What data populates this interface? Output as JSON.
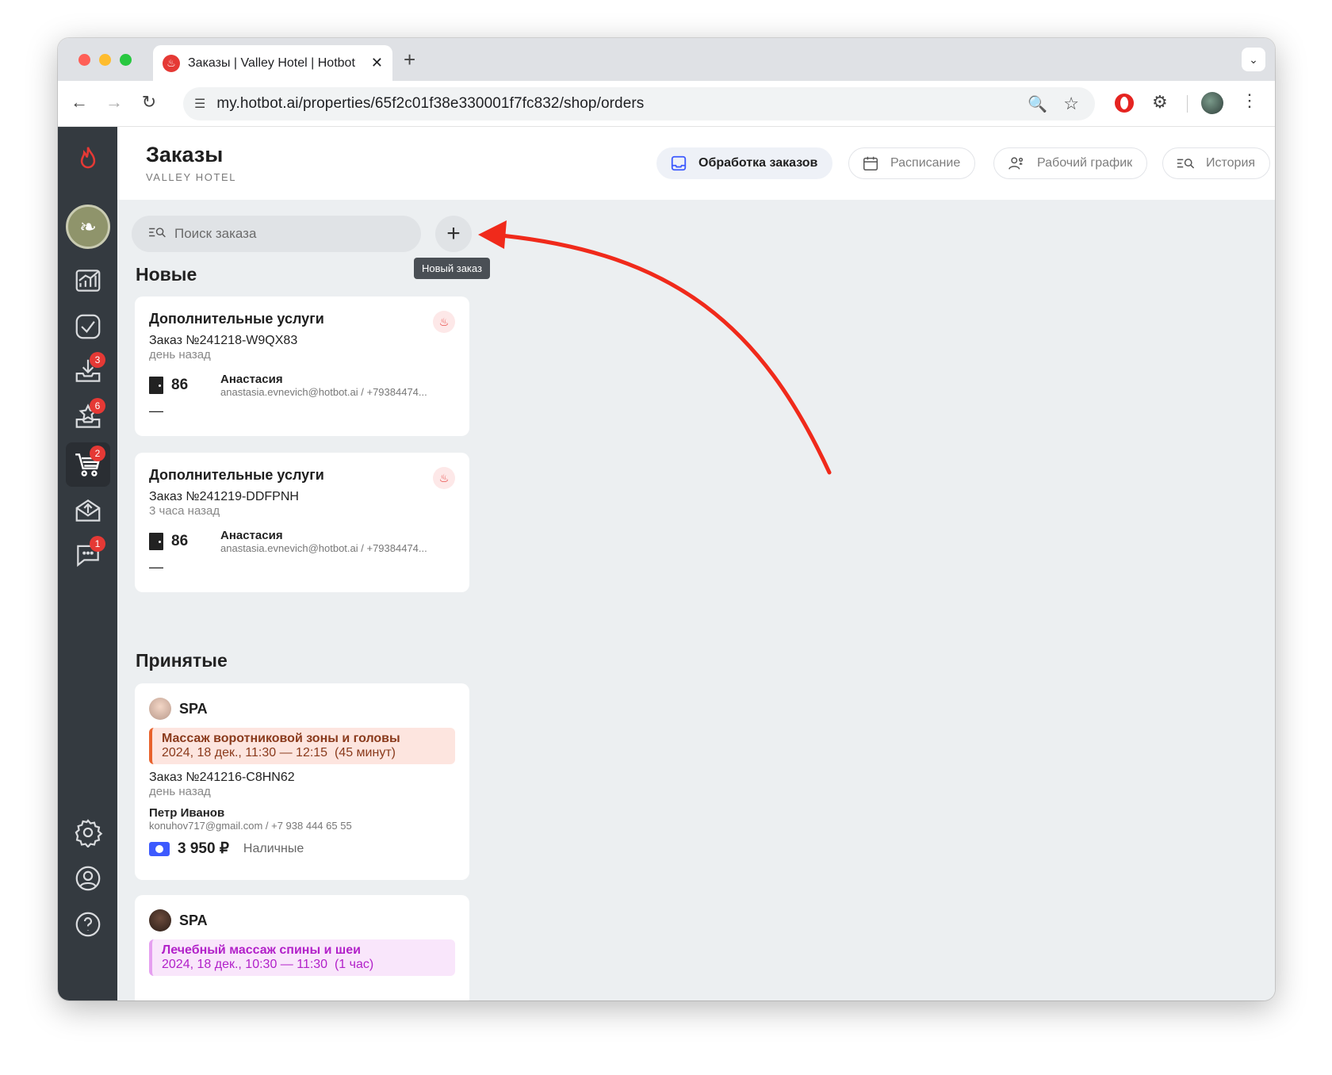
{
  "browser": {
    "tab_title": "Заказы | Valley Hotel | Hotbot",
    "url": "my.hotbot.ai/properties/65f2c01f38e330001f7fc832/shop/orders"
  },
  "sidebar": {
    "badges": {
      "downloads": "3",
      "reviews": "6",
      "orders": "2",
      "chat": "1"
    }
  },
  "header": {
    "title": "Заказы",
    "subtitle": "VALLEY HOTEL",
    "tabs": [
      {
        "label": "Обработка заказов",
        "icon": "inbox-icon",
        "active": true
      },
      {
        "label": "Расписание",
        "icon": "calendar-icon"
      },
      {
        "label": "Рабочий график",
        "icon": "staff-icon"
      },
      {
        "label": "История",
        "icon": "history-search-icon"
      }
    ]
  },
  "search": {
    "placeholder": "Поиск заказа"
  },
  "add_button": {
    "tooltip": "Новый заказ"
  },
  "sections": {
    "new": {
      "title": "Новые",
      "orders": [
        {
          "title": "Дополнительные услуги",
          "number": "Заказ №241218-W9QX83",
          "ago": "день назад",
          "room": "86",
          "guest_name": "Анастасия",
          "guest_contact": "anastasia.evnevich@hotbot.ai / +79384474...",
          "note": "—"
        },
        {
          "title": "Дополнительные услуги",
          "number": "Заказ №241219-DDFPNH",
          "ago": "3 часа назад",
          "room": "86",
          "guest_name": "Анастасия",
          "guest_contact": "anastasia.evnevich@hotbot.ai / +79384474...",
          "note": "—"
        }
      ]
    },
    "accepted": {
      "title": "Принятые",
      "orders": [
        {
          "category": "SPA",
          "service_name": "Массаж воротниковой зоны и головы",
          "service_time": "2024, 18 дек., 11:30 — 12:15  (45 минут)",
          "service_color": "#e8622c",
          "number": "Заказ №241216-C8HN62",
          "ago": "день назад",
          "guest_name": "Петр Иванов",
          "guest_contact": "konuhov717@gmail.com / +7 938 444 65 55",
          "amount": "3 950 ₽",
          "payment": "Наличные"
        },
        {
          "category": "SPA",
          "service_name": "Лечебный массаж спины и шеи",
          "service_time": "2024, 18 дек., 10:30 — 11:30  (1 час)",
          "service_color": "#c026d3"
        }
      ]
    }
  },
  "colors": {
    "accent": "#3d5afe",
    "sidebar": "#343a40",
    "annotation_arrow": "#f02a1b"
  }
}
